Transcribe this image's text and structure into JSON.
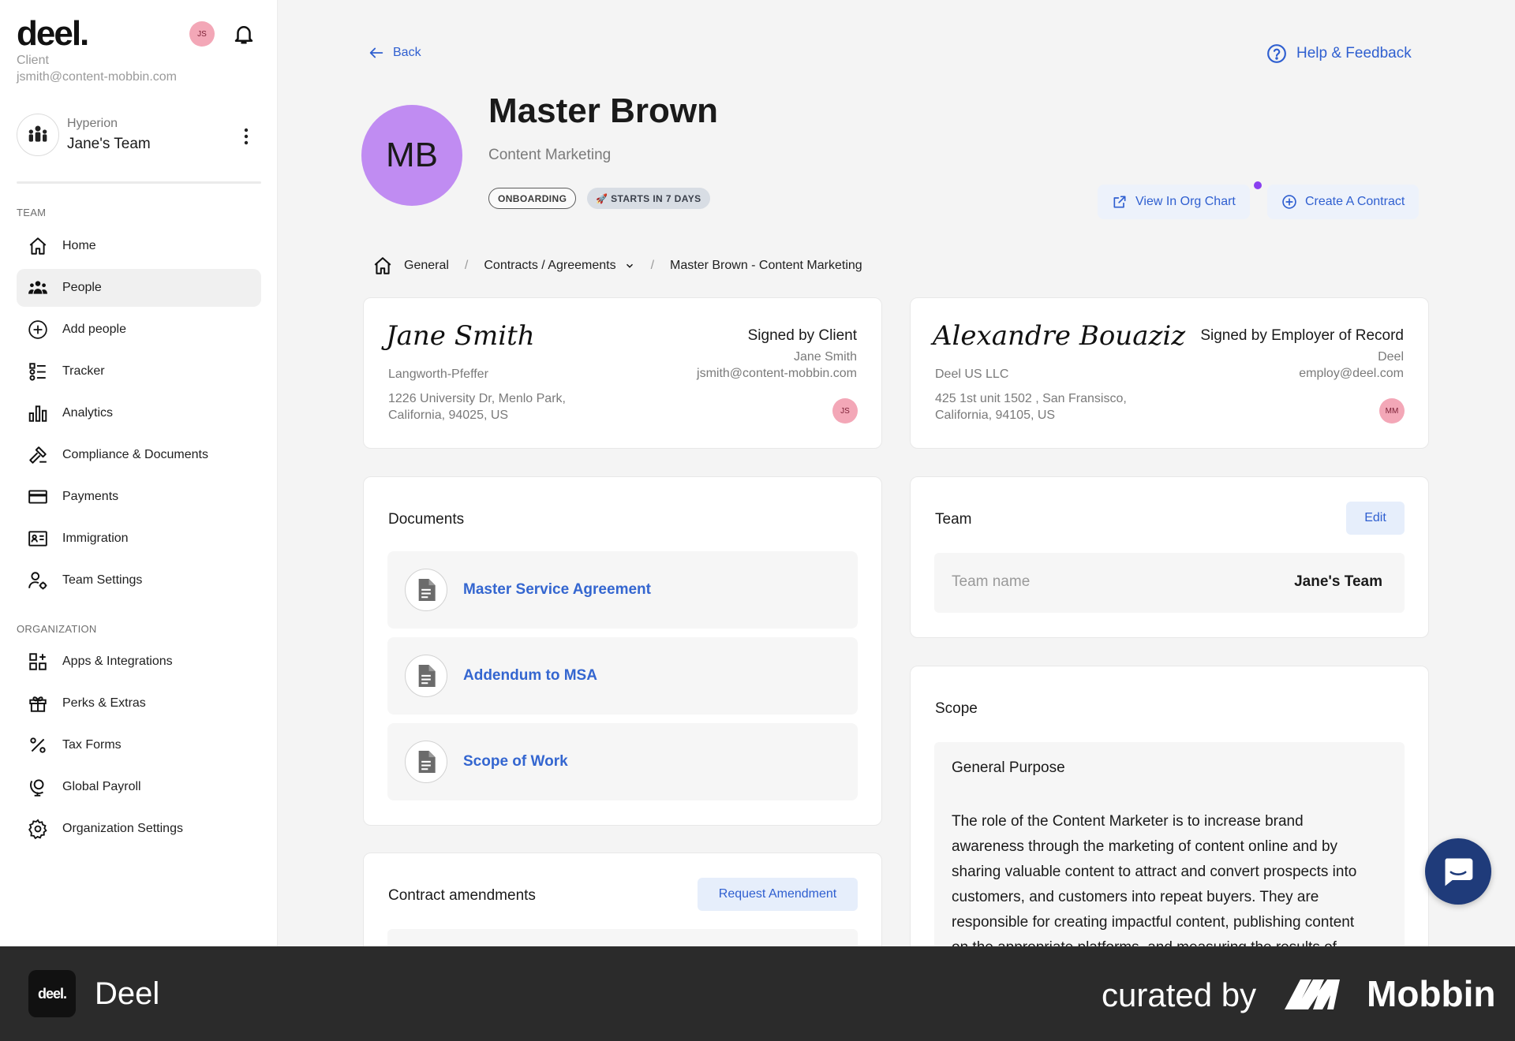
{
  "sidebar": {
    "logo": "deel.",
    "role": "Client",
    "email": "jsmith@content-mobbin.com",
    "user_initials": "JS",
    "team_org": "Hyperion",
    "team_name": "Jane's Team",
    "section_team": "TEAM",
    "section_org": "ORGANIZATION",
    "team_items": [
      {
        "label": "Home",
        "icon": "home-icon"
      },
      {
        "label": "People",
        "icon": "people-icon",
        "active": true
      },
      {
        "label": "Add people",
        "icon": "add-circle-icon"
      },
      {
        "label": "Tracker",
        "icon": "tracker-icon"
      },
      {
        "label": "Analytics",
        "icon": "bar-chart-icon"
      },
      {
        "label": "Compliance & Documents",
        "icon": "gavel-icon"
      },
      {
        "label": "Payments",
        "icon": "credit-card-icon"
      },
      {
        "label": "Immigration",
        "icon": "id-card-icon"
      },
      {
        "label": "Team Settings",
        "icon": "user-gear-icon"
      }
    ],
    "org_items": [
      {
        "label": "Apps & Integrations",
        "icon": "apps-grid-icon"
      },
      {
        "label": "Perks & Extras",
        "icon": "gift-icon"
      },
      {
        "label": "Tax Forms",
        "icon": "percent-icon"
      },
      {
        "label": "Global Payroll",
        "icon": "globe-stand-icon"
      },
      {
        "label": "Organization Settings",
        "icon": "gear-icon"
      }
    ]
  },
  "header": {
    "back_label": "Back",
    "help_label": "Help & Feedback",
    "avatar_initials": "MB",
    "name": "Master Brown",
    "job_title": "Content Marketing",
    "status_chip": "ONBOARDING",
    "start_chip": "🚀 STARTS IN 7 DAYS",
    "view_org_chart": "View In Org Chart",
    "create_contract": "Create A Contract",
    "accent_color": "#2f5fd0",
    "avatar_color": "#c08cf2"
  },
  "breadcrumb": {
    "items": [
      "General",
      "Contracts / Agreements",
      "Master Brown - Content Marketing"
    ]
  },
  "signatures": {
    "client": {
      "signature": "Jane Smith",
      "company": "Langworth-Pfeffer",
      "address_line1": "1226 University Dr, Menlo Park,",
      "address_line2": "California, 94025, US",
      "signed_by_label": "Signed by Client",
      "signer_name": "Jane Smith",
      "signer_email": "jsmith@content-mobbin.com",
      "initials": "JS"
    },
    "eor": {
      "signature": "Alexandre Bouaziz",
      "company": "Deel US LLC",
      "address_line1": "425 1st unit 1502 , San Fransisco,",
      "address_line2": "California, 94105, US",
      "signed_by_label": "Signed by Employer of Record",
      "signer_name": "Deel",
      "signer_email": "employ@deel.com",
      "initials": "MM"
    }
  },
  "documents": {
    "title": "Documents",
    "items": [
      "Master Service Agreement",
      "Addendum to MSA",
      "Scope of Work"
    ]
  },
  "amendments": {
    "title": "Contract amendments",
    "request_button": "Request Amendment"
  },
  "team_card": {
    "title": "Team",
    "edit_button": "Edit",
    "field_label": "Team name",
    "field_value": "Jane's Team"
  },
  "scope_card": {
    "title": "Scope",
    "heading": "General Purpose",
    "lines": [
      "The role of the Content Marketer is to increase brand",
      "awareness through the marketing of content online and by",
      "sharing valuable content to attract and convert prospects into",
      "customers, and customers into repeat buyers. They are",
      "responsible for creating impactful content, publishing content",
      "on the appropriate platforms, and measuring the results of"
    ]
  },
  "footer": {
    "logo": "deel.",
    "app_name": "Deel",
    "curated_by": "curated by",
    "brand": "Mobbin"
  }
}
